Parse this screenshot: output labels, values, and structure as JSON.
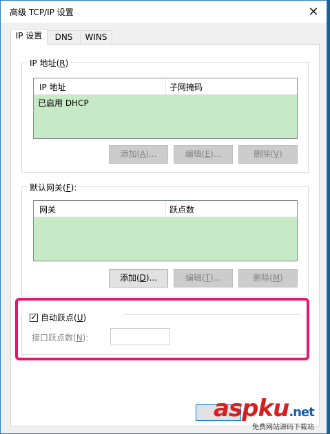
{
  "window": {
    "title": "高级 TCP/IP 设置",
    "close_glyph": "✕"
  },
  "tabs": [
    {
      "label": "IP 设置"
    },
    {
      "label": "DNS"
    },
    {
      "label": "WINS"
    }
  ],
  "ip_group": {
    "legend": "IP 地址(",
    "legend_key": "R",
    "legend_end": ")",
    "columns": [
      "IP 地址",
      "子网掩码"
    ],
    "rows": [
      {
        "ip": "已启用 DHCP",
        "mask": ""
      }
    ],
    "buttons": [
      {
        "label": "添加(",
        "key": "A",
        "end": ")..."
      },
      {
        "label": "编辑(",
        "key": "E",
        "end": ")..."
      },
      {
        "label": "删除(",
        "key": "V",
        "end": ")"
      }
    ]
  },
  "gateway_group": {
    "legend": "默认网关(",
    "legend_key": "F",
    "legend_end": "):",
    "columns": [
      "网关",
      "跃点数"
    ],
    "buttons": [
      {
        "label": "添加(",
        "key": "D",
        "end": ")..."
      },
      {
        "label": "编辑(",
        "key": "T",
        "end": ")..."
      },
      {
        "label": "删除(",
        "key": "M",
        "end": ")"
      }
    ]
  },
  "metric": {
    "auto_label": "自动跃点(",
    "auto_key": "U",
    "auto_end": ")",
    "checked": true,
    "check_glyph": "✓",
    "interface_label": "接口跃点数(",
    "interface_key": "N",
    "interface_end": "):",
    "interface_value": ""
  },
  "watermark": {
    "brand": "aspku",
    "dot": ".net",
    "sub": "免费网站源码下载站"
  },
  "colors": {
    "highlight": "#e8156d",
    "list_bg": "#c6e9c6"
  }
}
